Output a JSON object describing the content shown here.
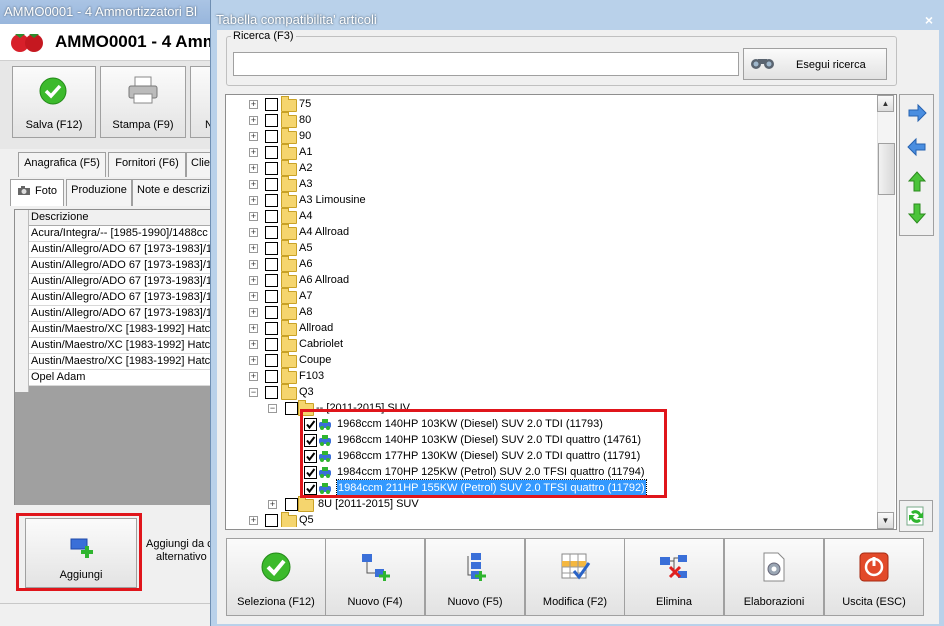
{
  "background_window": {
    "title": "AMMO0001 - 4 Ammortizzatori Bl",
    "header_title": "AMMO0001 - 4 Ammo",
    "toolbar": {
      "save": "Salva (F12)",
      "print": "Stampa (F9)",
      "partial": "N"
    },
    "tabs_top": [
      "Anagrafica (F5)",
      "Fornitori (F6)",
      "Clien"
    ],
    "tabs_bottom": [
      "Foto",
      "Produzione",
      "Note e descrizi"
    ],
    "list_header": "Descrizione",
    "list_rows": [
      "Acura/Integra/-- [1985-1990]/1488cc",
      "Austin/Allegro/ADO 67 [1973-1983]/1",
      "Austin/Allegro/ADO 67 [1973-1983]/1",
      "Austin/Allegro/ADO 67 [1973-1983]/1",
      "Austin/Allegro/ADO 67 [1973-1983]/1",
      "Austin/Allegro/ADO 67 [1973-1983]/1",
      "Austin/Maestro/XC [1983-1992] Hatch",
      "Austin/Maestro/XC [1983-1992] Hatch",
      "Austin/Maestro/XC [1983-1992] Hatch",
      "Opel Adam"
    ],
    "add_button": "Aggiungi",
    "add_alt_text": [
      "Aggiungi da c",
      "alternativo (("
    ]
  },
  "dialog": {
    "title": "Tabella compatibilita' articoli",
    "close": "×",
    "search": {
      "legend": "Ricerca (F3)",
      "value": "",
      "button": "Esegui ricerca"
    },
    "tree": {
      "models": [
        "75",
        "80",
        "90",
        "A1",
        "A2",
        "A3",
        "A3 Limousine",
        "A4",
        "A4 Allroad",
        "A5",
        "A6",
        "A6 Allroad",
        "A7",
        "A8",
        "Allroad",
        "Cabriolet",
        "Coupe",
        "F103",
        "Q3"
      ],
      "q3_group": "-- [2011-2015] SUV",
      "engines": [
        "1968ccm 140HP 103KW (Diesel) SUV 2.0 TDI (11793)",
        "1968ccm 140HP 103KW (Diesel) SUV 2.0 TDI quattro (14761)",
        "1968ccm 177HP 130KW (Diesel) SUV 2.0 TDI quattro (11791)",
        "1984ccm 170HP 125KW (Petrol) SUV 2.0 TFSI quattro (11794)",
        "1984ccm 211HP 155KW (Petrol) SUV 2.0 TFSI quattro (11792)"
      ],
      "q3_group2": "8U [2011-2015] SUV",
      "after": [
        "Q5"
      ]
    },
    "side_buttons": [
      "arrow-right-icon",
      "arrow-left-icon",
      "arrow-up-icon",
      "arrow-down-icon"
    ],
    "bottom_buttons": [
      "Seleziona (F12)",
      "Nuovo (F4)",
      "Nuovo (F5)",
      "Modifica (F2)",
      "Elimina",
      "Elaborazioni",
      "Uscita (ESC)"
    ]
  }
}
